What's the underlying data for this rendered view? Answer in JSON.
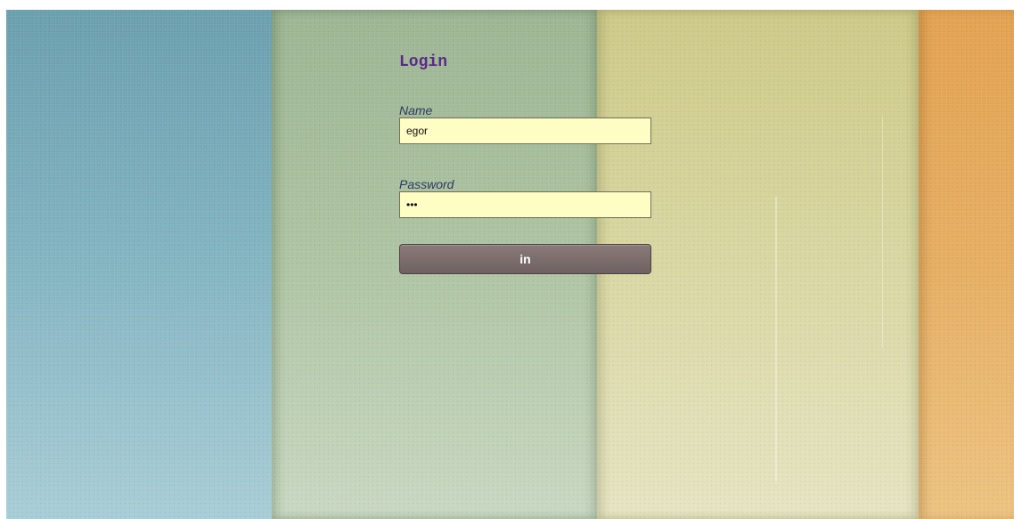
{
  "login": {
    "title": "Login",
    "name_label": "Name",
    "name_value": "egor",
    "password_label": "Password",
    "password_value": "abc",
    "submit_label": "in"
  },
  "colors": {
    "stripe_blue": "#80b2c0",
    "stripe_green": "#aec4a3",
    "stripe_yellow": "#d9d7a2",
    "stripe_orange": "#e6ae62",
    "title": "#5a2a86",
    "label": "#2e3a62",
    "input_background": "#fdfdc4",
    "button": "#7d6e6e"
  }
}
